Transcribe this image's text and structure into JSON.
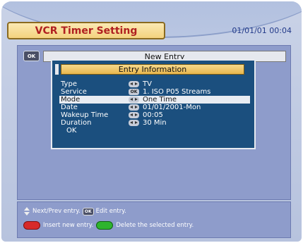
{
  "header": {
    "title": "VCR Timer Setting",
    "clock": "01/01/01 00:04"
  },
  "panel": {
    "ok_badge": "OK",
    "title": "New Entry"
  },
  "dialog": {
    "title": "Entry Information",
    "rows": [
      {
        "label": "Type",
        "control": "left-right-arrows-icon",
        "value": "TV"
      },
      {
        "label": "Service",
        "control": "ok-icon",
        "value": "1. ISO P05 Streams"
      },
      {
        "label": "Mode",
        "control": "left-right-arrows-icon",
        "value": "One Time",
        "selected": true
      },
      {
        "label": "Date",
        "control": "left-right-arrows-icon",
        "value": "01/01/2001-Mon"
      },
      {
        "label": "Wakeup Time",
        "control": "left-right-arrows-icon",
        "value": "00:05"
      },
      {
        "label": "Duration",
        "control": "left-right-arrows-icon",
        "value": "30 Min"
      }
    ],
    "ok_label": "OK"
  },
  "help": {
    "line1_a": "Next/Prev entry.",
    "line1_ok": "OK",
    "line1_b": "Edit entry.",
    "line2_a": "Insert new entry.",
    "line2_b": "Delete the selected entry."
  },
  "colors": {
    "accent_red": "#d72a2a",
    "accent_green": "#2eb42e",
    "dialog_bg": "#1b4f7e",
    "title_gold": "#f4d27e"
  }
}
